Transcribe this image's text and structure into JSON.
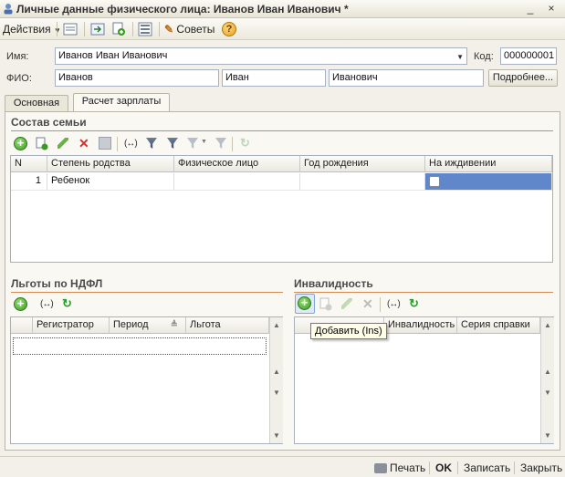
{
  "window": {
    "title": "Личные данные физического лица: Иванов Иван Иванович *",
    "minimize": "_",
    "close": "×"
  },
  "toolbar": {
    "actions_label": "Действия",
    "tips_label": "Советы",
    "help_glyph": "?"
  },
  "form": {
    "name_label": "Имя:",
    "name_value": "Иванов Иван Иванович",
    "code_label": "Код:",
    "code_value": "000000001",
    "fio_label": "ФИО:",
    "last_name": "Иванов",
    "first_name": "Иван",
    "patronymic": "Иванович",
    "details_button": "Подробнее..."
  },
  "tabs": [
    {
      "label": "Основная",
      "active": false
    },
    {
      "label": "Расчет зарплаты",
      "active": true
    }
  ],
  "family": {
    "title": "Состав семьи",
    "columns": [
      "N",
      "Степень родства",
      "Физическое лицо",
      "Год рождения",
      "На иждивении"
    ],
    "rows": [
      {
        "n": "1",
        "relation": "Ребенок",
        "person": "",
        "birth_year": "",
        "dependent": false
      }
    ]
  },
  "ndfl": {
    "title": "Льготы по НДФЛ",
    "columns": [
      "Регистратор",
      "Период",
      "Льгота"
    ]
  },
  "disability": {
    "title": "Инвалидность",
    "columns": [
      "Инвалидность",
      "Серия справки"
    ],
    "tooltip": "Добавить (Ins)"
  },
  "status": {
    "print_label": "Печать",
    "ok_label": "OK",
    "save_label": "Записать",
    "close_label": "Закрыть"
  },
  "colors": {
    "selection": "#5f87c9",
    "section_line": "#d48a52",
    "accent_green": "#3a9a22"
  }
}
